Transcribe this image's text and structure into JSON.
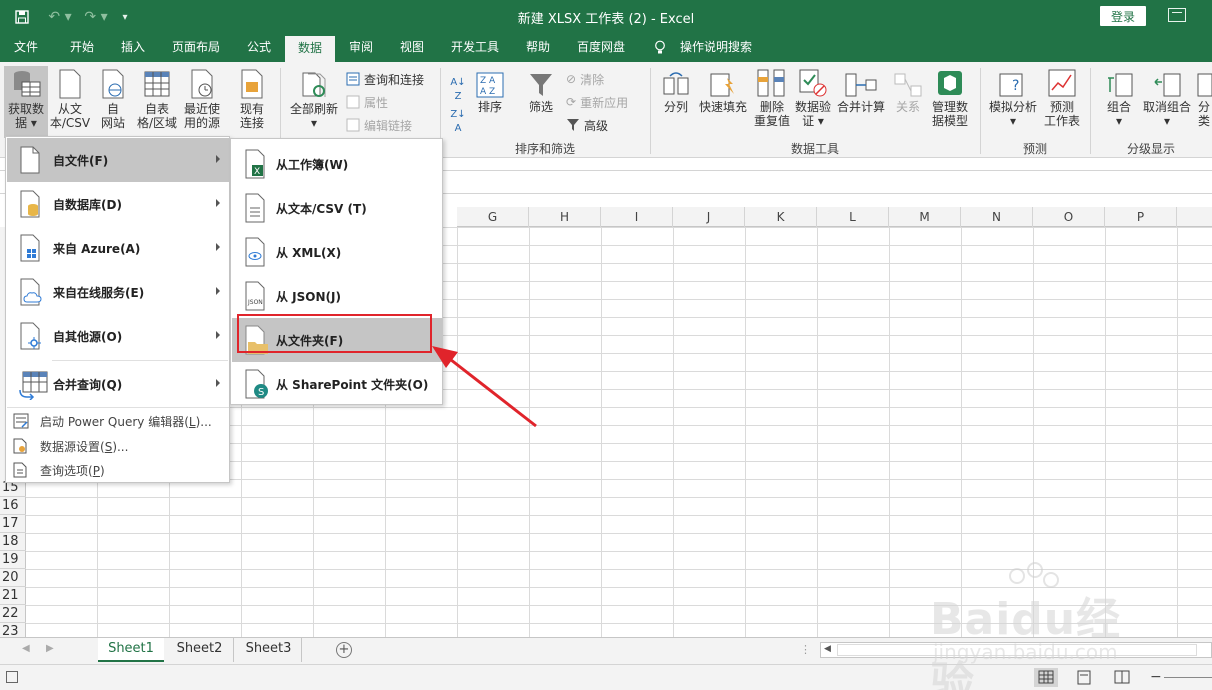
{
  "window": {
    "title": "新建 XLSX 工作表 (2)  -  Excel",
    "login_label": "登录"
  },
  "tabs": [
    {
      "label": "文件"
    },
    {
      "label": "开始"
    },
    {
      "label": "插入"
    },
    {
      "label": "页面布局"
    },
    {
      "label": "公式"
    },
    {
      "label": "数据"
    },
    {
      "label": "审阅"
    },
    {
      "label": "视图"
    },
    {
      "label": "开发工具"
    },
    {
      "label": "帮助"
    },
    {
      "label": "百度网盘"
    },
    {
      "label": "操作说明搜索"
    }
  ],
  "ribbon": {
    "get_data": [
      "获取数",
      "据"
    ],
    "from_text_csv": [
      "从文",
      "本/CSV"
    ],
    "from_web": [
      "自",
      "网站"
    ],
    "from_table": [
      "自表",
      "格/区域"
    ],
    "recent_sources": [
      "最近使",
      "用的源"
    ],
    "existing_conn": [
      "现有",
      "连接"
    ],
    "refresh_all": "全部刷新",
    "queries_conn": "查询和连接",
    "properties": "属性",
    "edit_links": "编辑链接",
    "sort": "排序",
    "filter": "筛选",
    "clear": "清除",
    "reapply": "重新应用",
    "advanced": "高级",
    "group_sort_filter": "排序和筛选",
    "text_to_cols": "分列",
    "flash_fill": "快速填充",
    "remove_dup": [
      "删除",
      "重复值"
    ],
    "data_validation": [
      "数据验",
      "证"
    ],
    "consolidate": "合并计算",
    "relationships": "关系",
    "manage_model": [
      "管理数",
      "据模型"
    ],
    "group_data_tools": "数据工具",
    "what_if": "模拟分析",
    "forecast_sheet": [
      "预测",
      "工作表"
    ],
    "group_forecast": "预测",
    "group": "组合",
    "ungroup": "取消组合",
    "subtotal": "分类",
    "group_outline": "分级显示"
  },
  "columns": [
    "G",
    "H",
    "I",
    "J",
    "K",
    "L",
    "M",
    "N",
    "O",
    "P"
  ],
  "rows": [
    "15",
    "16",
    "17",
    "18",
    "19",
    "20",
    "21",
    "22",
    "23"
  ],
  "menu_main": [
    {
      "label": "自文件",
      "key": "(F)"
    },
    {
      "label": "自数据库",
      "key": "(D)"
    },
    {
      "label": "来自 Azure",
      "key": "(A)"
    },
    {
      "label": "来自在线服务",
      "key": "(E)"
    },
    {
      "label": "自其他源",
      "key": "(O)"
    },
    {
      "label": "合并查询",
      "key": "(Q)"
    }
  ],
  "menu_small": [
    {
      "label": "启动 Power Query 编辑器(",
      "key": "L",
      "suffix": ")..."
    },
    {
      "label": "数据源设置(",
      "key": "S",
      "suffix": ")..."
    },
    {
      "label": "查询选项(",
      "key": "P",
      "suffix": ")"
    }
  ],
  "menu_sub": [
    {
      "label": "从工作簿",
      "key": "(W)"
    },
    {
      "label": "从文本/CSV ",
      "key": "(T)"
    },
    {
      "label": "从 XML",
      "key": "(X)"
    },
    {
      "label": "从 JSON",
      "key": "(J)"
    },
    {
      "label": "从文件夹",
      "key": "(F)"
    },
    {
      "label": "从 SharePoint 文件夹",
      "key": "(O)"
    }
  ],
  "sheets": [
    "Sheet1",
    "Sheet2",
    "Sheet3"
  ],
  "watermark": {
    "brand": "Baidu经验",
    "url": "jingyan.baidu.com"
  },
  "colors": {
    "excel_green": "#217346",
    "highlight_red": "#e0242b"
  }
}
